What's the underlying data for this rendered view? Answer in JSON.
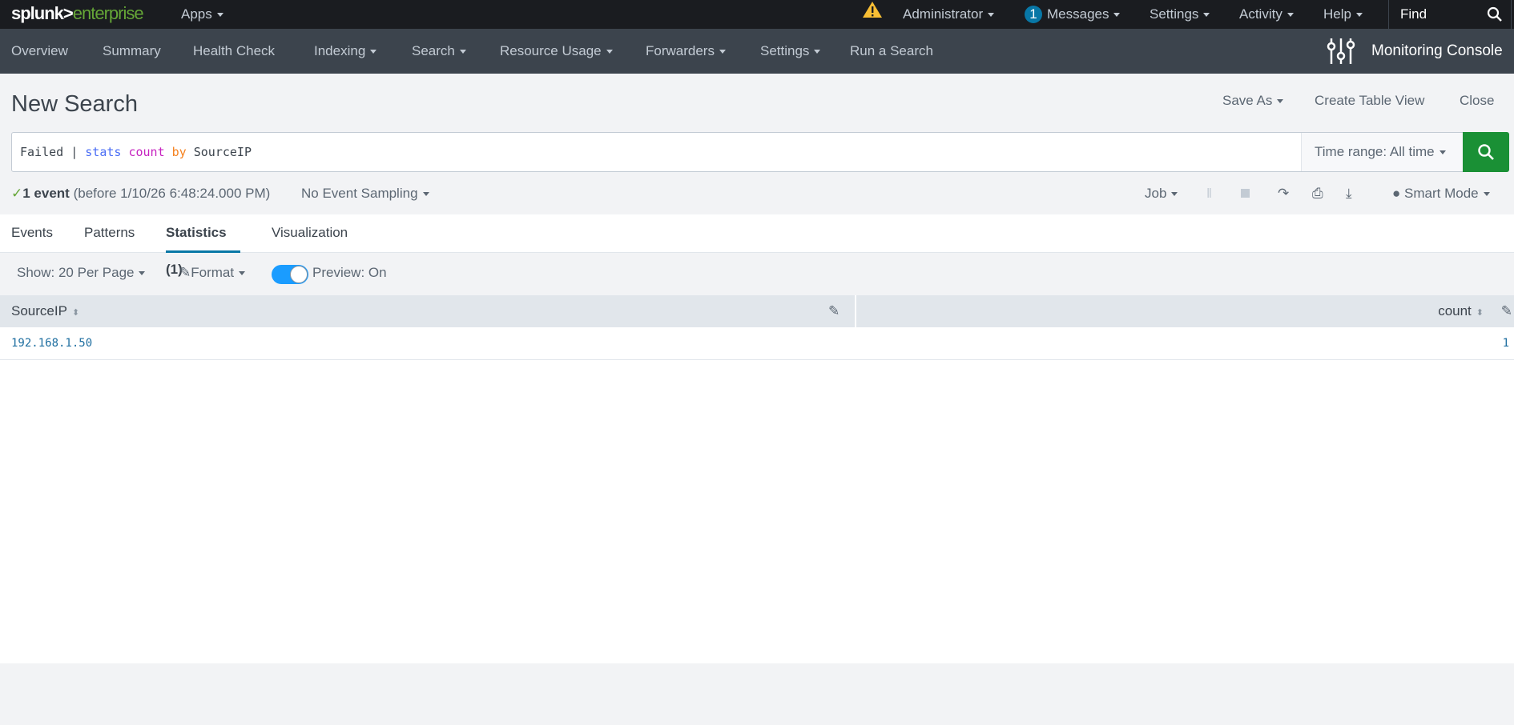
{
  "topbar": {
    "logo_main": "splunk>",
    "logo_accent": "enterprise",
    "apps": "Apps",
    "admin": "Administrator",
    "messages_count": "1",
    "messages": "Messages",
    "settings": "Settings",
    "activity": "Activity",
    "help": "Help",
    "find": "Find"
  },
  "nav": {
    "items": [
      "Overview",
      "Summary",
      "Health Check",
      "Indexing",
      "Search",
      "Resource Usage",
      "Forwarders",
      "Settings",
      "Run a Search"
    ],
    "app_title": "Monitoring Console"
  },
  "page": {
    "title": "New Search",
    "save_as": "Save As",
    "create_table": "Create Table View",
    "close": "Close"
  },
  "search": {
    "q_plain1": "Failed | ",
    "q_cmd": "stats",
    "q_fn": "count",
    "q_by": "by",
    "q_field": "SourceIP",
    "time_range": "Time range: All time"
  },
  "status": {
    "count": "1 event",
    "detail": "(before 1/10/26 6:48:24.000 PM)",
    "sampling": "No Event Sampling",
    "job": "Job",
    "mode": "Smart Mode"
  },
  "tabs": [
    "Events",
    "Patterns",
    "Statistics (1)",
    "Visualization"
  ],
  "controls": {
    "show": "Show: 20 Per Page",
    "format": "Format",
    "preview": "Preview: On"
  },
  "table": {
    "columns": [
      "SourceIP",
      "count"
    ],
    "rows": [
      [
        "192.168.1.50",
        "1"
      ]
    ]
  },
  "colors": {
    "accent": "#0877a6",
    "go": "#1a9035",
    "toggle": "#1a9cff"
  }
}
